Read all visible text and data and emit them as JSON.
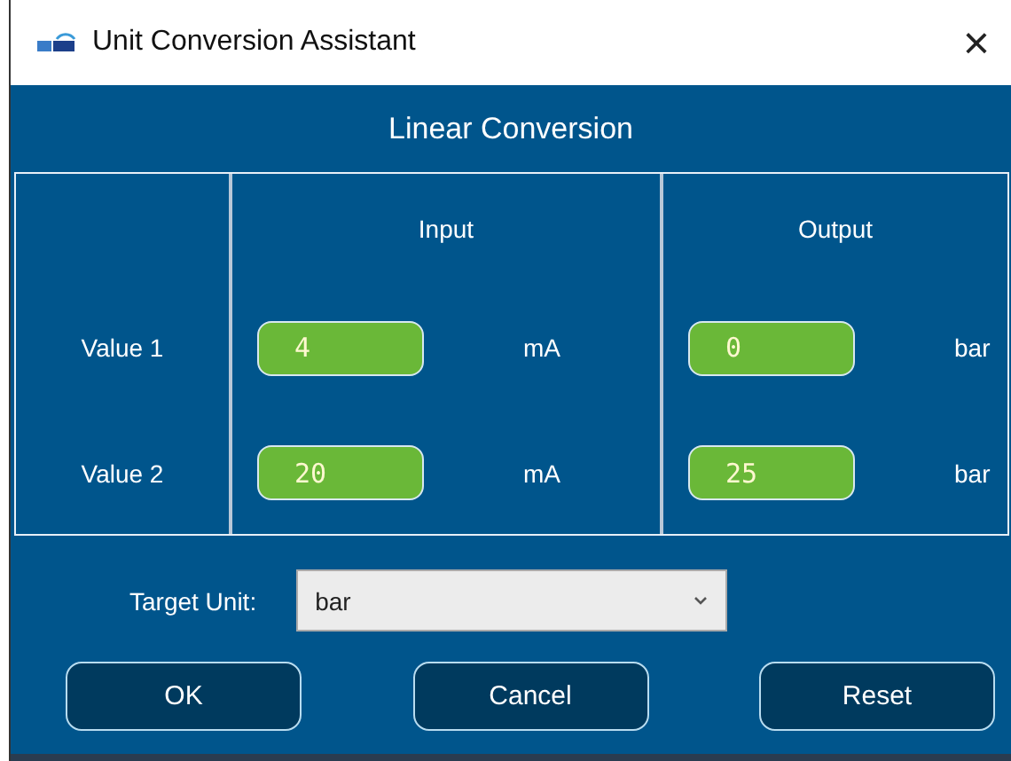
{
  "window": {
    "title": "Unit Conversion Assistant",
    "close": "×"
  },
  "header": "Linear Conversion",
  "columns": [
    "Input",
    "Output"
  ],
  "rows": [
    {
      "label": "Value 1",
      "input": "4",
      "input_unit": "mA",
      "output": "0",
      "output_unit": "bar"
    },
    {
      "label": "Value 2",
      "input": "20",
      "input_unit": "mA",
      "output": "25",
      "output_unit": "bar"
    }
  ],
  "target_unit": {
    "label": "Target Unit:",
    "value": "bar"
  },
  "buttons": [
    "OK",
    "Cancel",
    "Reset"
  ]
}
